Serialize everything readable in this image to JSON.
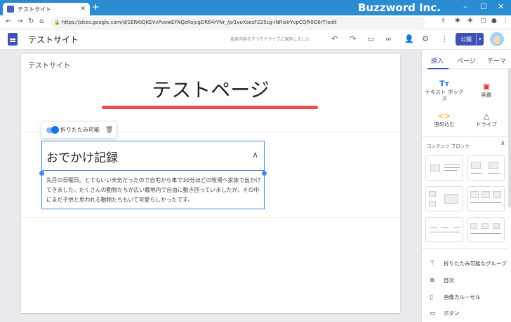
{
  "browser": {
    "tab_title": "テストサイト",
    "tab_close": "✕",
    "new_tab": "+",
    "url": "https://sites.google.com/d/1ERKIQKEVvPvowEFNQzRojcgDR64rYNr_/p/1voXsesF225cg-INRisIrYvpCQPi0G6rT/edit",
    "watermark": "Buzzword Inc.",
    "min_icon": "–",
    "max_icon": "☐",
    "close_icon": "✕"
  },
  "header": {
    "site_name": "テストサイト",
    "save_status": "変更内容をすべてドライブに保存しました",
    "publish_label": "公開"
  },
  "page": {
    "site_name": "テストサイト",
    "title": "テストページ",
    "accent_color": "#ee4b4b",
    "toggle_label": "折りたたみ可能",
    "collapsible": {
      "title": "おでかけ記録",
      "body": "先月の日曜日。とてもいい天気だったので自宅から車で30分ほどの牧場へ家族で出かけてきました。たくさんの動物たちが広い敷地内で自由に動き回っていましたが、その中にまだ子供と思われる動物たちもいて可愛らしかったです。"
    }
  },
  "panel": {
    "tabs": [
      "挿入",
      "ページ",
      "テーマ"
    ],
    "insert_items": [
      {
        "label": "テキスト ボックス",
        "icon": "text-box-icon",
        "glyph": "Tт"
      },
      {
        "label": "画像",
        "icon": "image-icon",
        "glyph": "▣"
      },
      {
        "label": "埋め込む",
        "icon": "embed-icon",
        "glyph": "<>"
      },
      {
        "label": "ドライブ",
        "icon": "drive-icon",
        "glyph": "△"
      }
    ],
    "content_blocks_title": "コンテンツ ブロック",
    "list_items": [
      {
        "label": "折りたたみ可能なグループ",
        "glyph": "⊤"
      },
      {
        "label": "目次",
        "glyph": "≣"
      },
      {
        "label": "画像カルーセル",
        "glyph": "▯"
      },
      {
        "label": "ボタン",
        "glyph": "▭"
      }
    ]
  }
}
